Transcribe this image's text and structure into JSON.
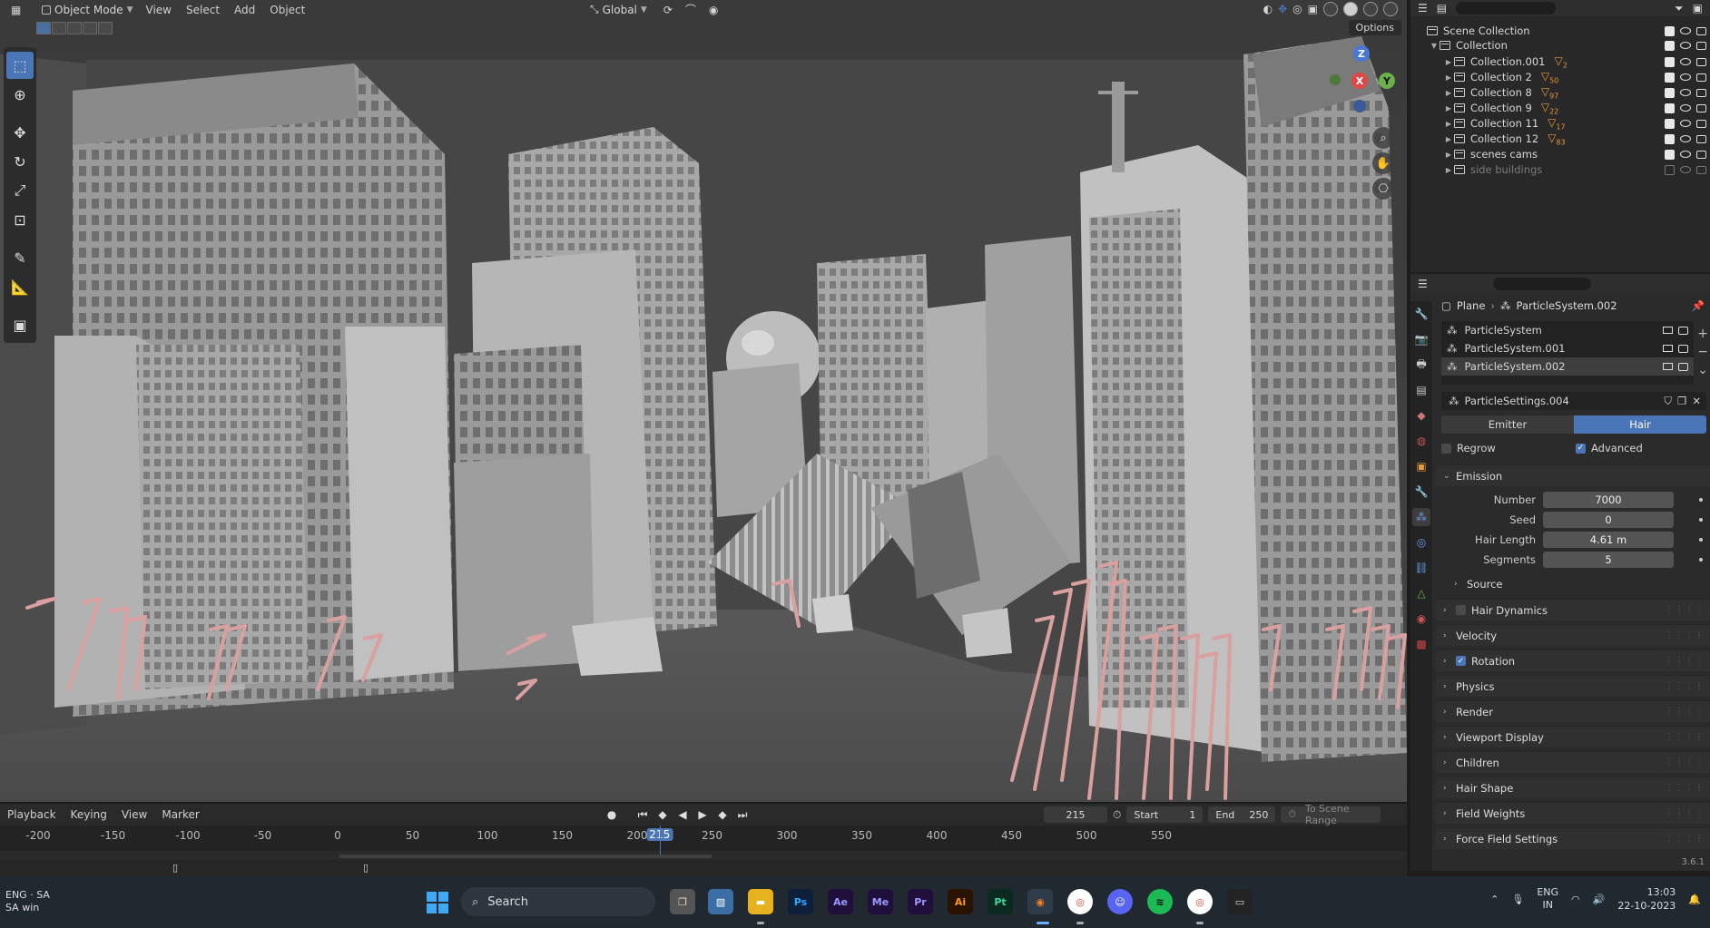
{
  "viewport": {
    "mode": "Object Mode",
    "menus": [
      "View",
      "Select",
      "Add",
      "Object"
    ],
    "orientation": "Global",
    "options_label": "Options",
    "gizmo": {
      "x": "X",
      "y": "Y",
      "z": "Z"
    }
  },
  "timeline": {
    "menus": [
      "Playback",
      "Keying",
      "View",
      "Marker"
    ],
    "current_frame": "215",
    "start_label": "Start",
    "start_value": "1",
    "end_label": "End",
    "end_value": "250",
    "scene_range_label": "To Scene Range",
    "ruler_ticks": [
      "-200",
      "-150",
      "-100",
      "-50",
      "0",
      "50",
      "100",
      "150",
      "200",
      "250",
      "300",
      "350",
      "400",
      "450",
      "500",
      "550"
    ],
    "playhead_label": "215"
  },
  "outliner": {
    "root": "Scene Collection",
    "collection": "Collection",
    "items": [
      {
        "label": "Collection.001",
        "badge": "2"
      },
      {
        "label": "Collection 2",
        "badge": "50"
      },
      {
        "label": "Collection 8",
        "badge": "97"
      },
      {
        "label": "Collection 9",
        "badge": "22"
      },
      {
        "label": "Collection 11",
        "badge": "17"
      },
      {
        "label": "Collection 12",
        "badge": "83"
      },
      {
        "label": "scenes cams",
        "badge": ""
      },
      {
        "label": "side buildings",
        "badge": ""
      }
    ]
  },
  "properties": {
    "breadcrumb_object": "Plane",
    "breadcrumb_system": "ParticleSystem.002",
    "systems": [
      "ParticleSystem",
      "ParticleSystem.001",
      "ParticleSystem.002"
    ],
    "settings_name": "ParticleSettings.004",
    "type_emitter": "Emitter",
    "type_hair": "Hair",
    "regrow_label": "Regrow",
    "advanced_label": "Advanced",
    "emission_label": "Emission",
    "fields": [
      {
        "label": "Number",
        "value": "7000"
      },
      {
        "label": "Seed",
        "value": "0"
      },
      {
        "label": "Hair Length",
        "value": "4.61 m"
      },
      {
        "label": "Segments",
        "value": "5"
      }
    ],
    "source_label": "Source",
    "panels": [
      "Hair Dynamics",
      "Velocity",
      "Rotation",
      "Physics",
      "Render",
      "Viewport Display",
      "Children",
      "Hair Shape",
      "Field Weights",
      "Force Field Settings"
    ],
    "version": "3.6.1"
  },
  "taskbar": {
    "lang_top": "ENG · SA",
    "lang_bottom": "SA win",
    "search_label": "Search",
    "apps": [
      "Ps",
      "Ae",
      "Me",
      "Pr",
      "Ai",
      "Pt"
    ],
    "tray_lang_top": "ENG",
    "tray_lang_bottom": "IN",
    "time": "13:03",
    "date": "22-10-2023"
  },
  "colors": {
    "accent": "#4a76b8",
    "particle_pink": "#d9a0a0",
    "object_orange": "#e89a3c"
  }
}
